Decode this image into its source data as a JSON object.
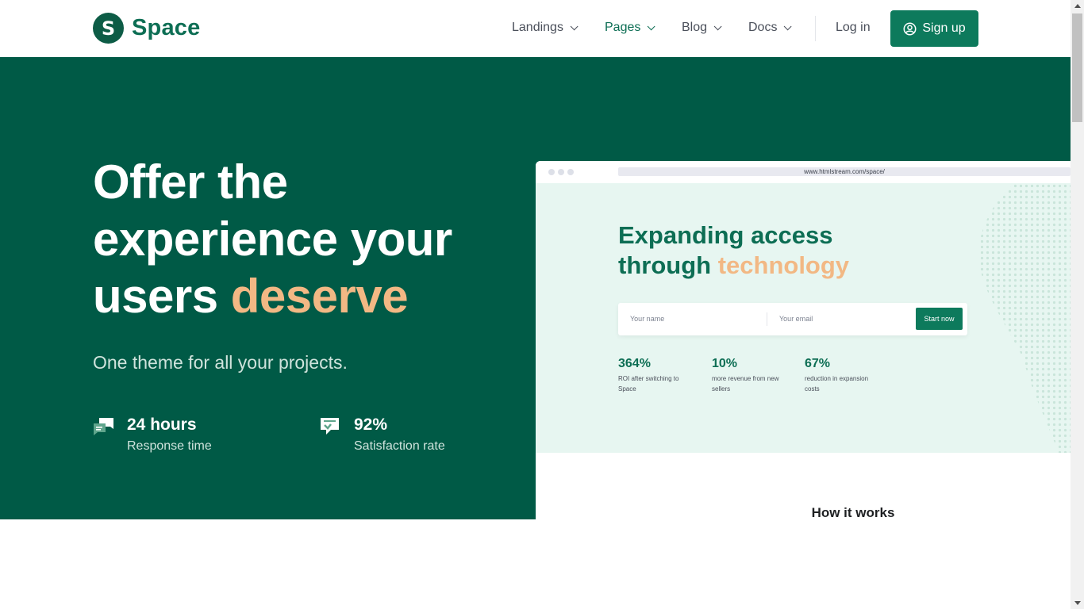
{
  "brand": {
    "logo_letter": "S",
    "name": "Space"
  },
  "nav": {
    "items": [
      {
        "label": "Landings"
      },
      {
        "label": "Pages"
      },
      {
        "label": "Blog"
      },
      {
        "label": "Docs"
      }
    ],
    "login": "Log in",
    "signup": "Sign up"
  },
  "hero": {
    "title_line1": "Offer the",
    "title_line2": "experience your",
    "title_line3": "users",
    "title_accent": "deserve",
    "subtitle": "One theme for all your projects.",
    "stats": [
      {
        "value": "24 hours",
        "label": "Response time",
        "icon": "chat-bubbles-icon"
      },
      {
        "value": "92%",
        "label": "Satisfaction rate",
        "icon": "chat-check-icon"
      }
    ]
  },
  "preview": {
    "url": "www.htmlstream.com/space/",
    "title_line1": "Expanding access",
    "title_line2": "through",
    "title_accent": "technology",
    "name_placeholder": "Your name",
    "email_placeholder": "Your email",
    "button": "Start now",
    "stats": [
      {
        "value": "364%",
        "label": "ROI after switching to Space"
      },
      {
        "value": "10%",
        "label": "more revenue from new sellers"
      },
      {
        "value": "67%",
        "label": "reduction in expansion costs"
      }
    ],
    "section_title": "How it works"
  },
  "colors": {
    "brand_green": "#0d7a5c",
    "hero_bg": "#005a46",
    "accent_orange": "#f2b884",
    "preview_bg": "#e7f6f1"
  }
}
